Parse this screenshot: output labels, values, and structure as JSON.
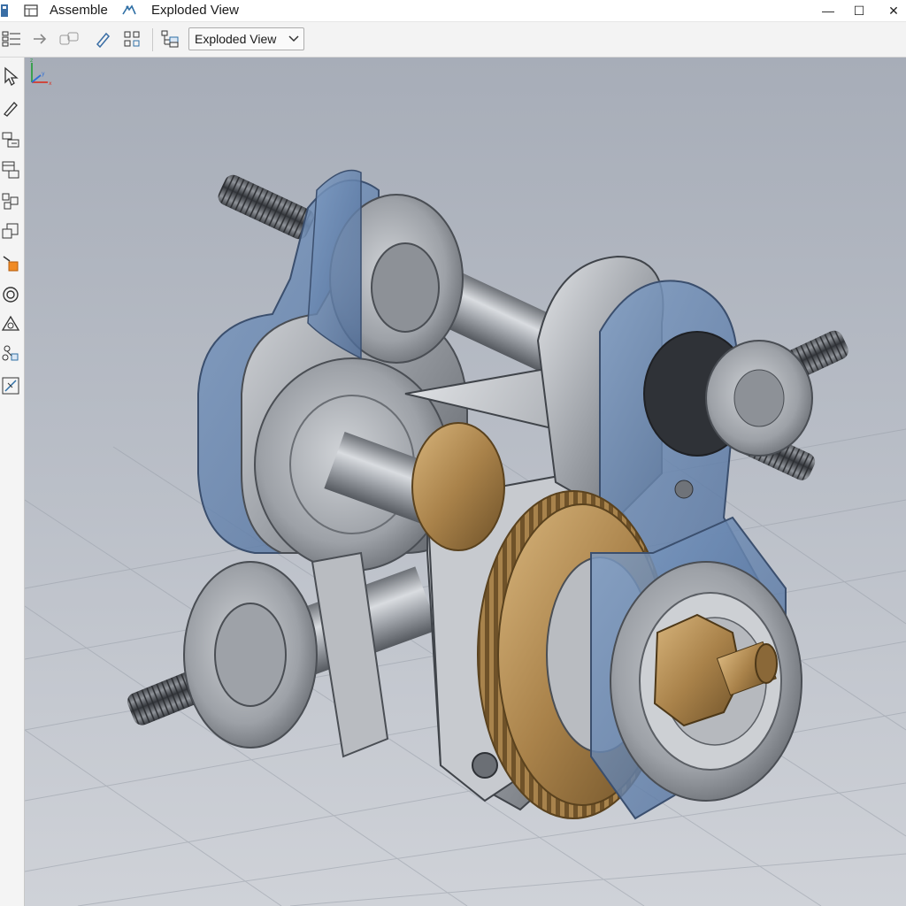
{
  "titlebar": {
    "menu_assemble": "Assemble",
    "menu_exploded": "Exploded View",
    "minimize": "—",
    "maximize": "☐",
    "close": "✕"
  },
  "toolbar": {
    "icons": [
      "list-icon",
      "arrow-right-icon",
      "link-icon",
      "pencil-icon",
      "grid-icon",
      "tree-icon"
    ],
    "view_select": {
      "value": "Exploded View",
      "options": [
        "Exploded View"
      ]
    }
  },
  "palette": {
    "icons": [
      "select-cursor-icon",
      "pencil-icon",
      "component-add-icon",
      "component-table-icon",
      "pattern-icon",
      "copy-icon",
      "constraint-icon",
      "ring-icon",
      "triangle-icon",
      "tree-icon",
      "explode-icon"
    ]
  },
  "triad": {
    "axes": [
      "z",
      "y",
      "x"
    ],
    "colors": {
      "z": "#2f9e44",
      "y": "#2f6fd6",
      "x": "#d33a2c"
    }
  },
  "colors": {
    "accent_blue": "#5b7fae",
    "steel": "#9a9ea4",
    "bronze": "#b38a52"
  }
}
